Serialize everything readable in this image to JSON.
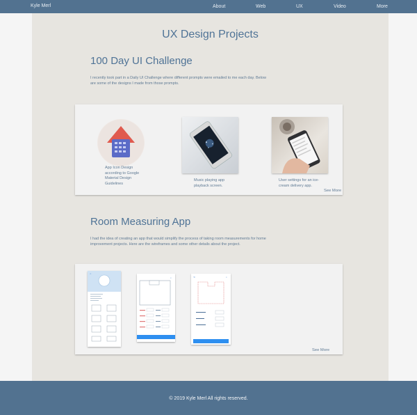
{
  "nav": {
    "brand": "Kyle Merl",
    "links": [
      "About",
      "Web",
      "UX",
      "Video",
      "More"
    ]
  },
  "page_title": "UX Design Projects",
  "sections": [
    {
      "title": "100 Day UI Challenge",
      "desc": "I recently took part in a Daily UI Challenge where different prompts were emailed to me each day.  Below are some of the  designs I made from those prompts.",
      "items": [
        {
          "caption": "App Icon Design according to Google Material Design Guidelines",
          "image": "house-calculator-app-icon"
        },
        {
          "caption": "Music playing app playback screen.",
          "image": "phone-music-player-photo"
        },
        {
          "caption": "User settings for an ice-cream delivery app.",
          "image": "hand-holding-phone-photo"
        }
      ],
      "see_more": "See More"
    },
    {
      "title": "Room Measuring App",
      "desc": "I had the idea of creating an app that would simplify the process of taking room measurements for home improvement projects.  Here are the wireframes and some other details about the project.",
      "wireframes": [
        "wireframe-profile-screen",
        "wireframe-measurement-screen",
        "wireframe-floorplan-screen"
      ],
      "see_more": "See More"
    }
  ],
  "footer": "© 2019 Kyle Merl All rights reserved.",
  "colors": {
    "nav": "#527290",
    "panel": "#e7e5e0",
    "accent": "#4f7396",
    "button": "#2e8ff0"
  }
}
